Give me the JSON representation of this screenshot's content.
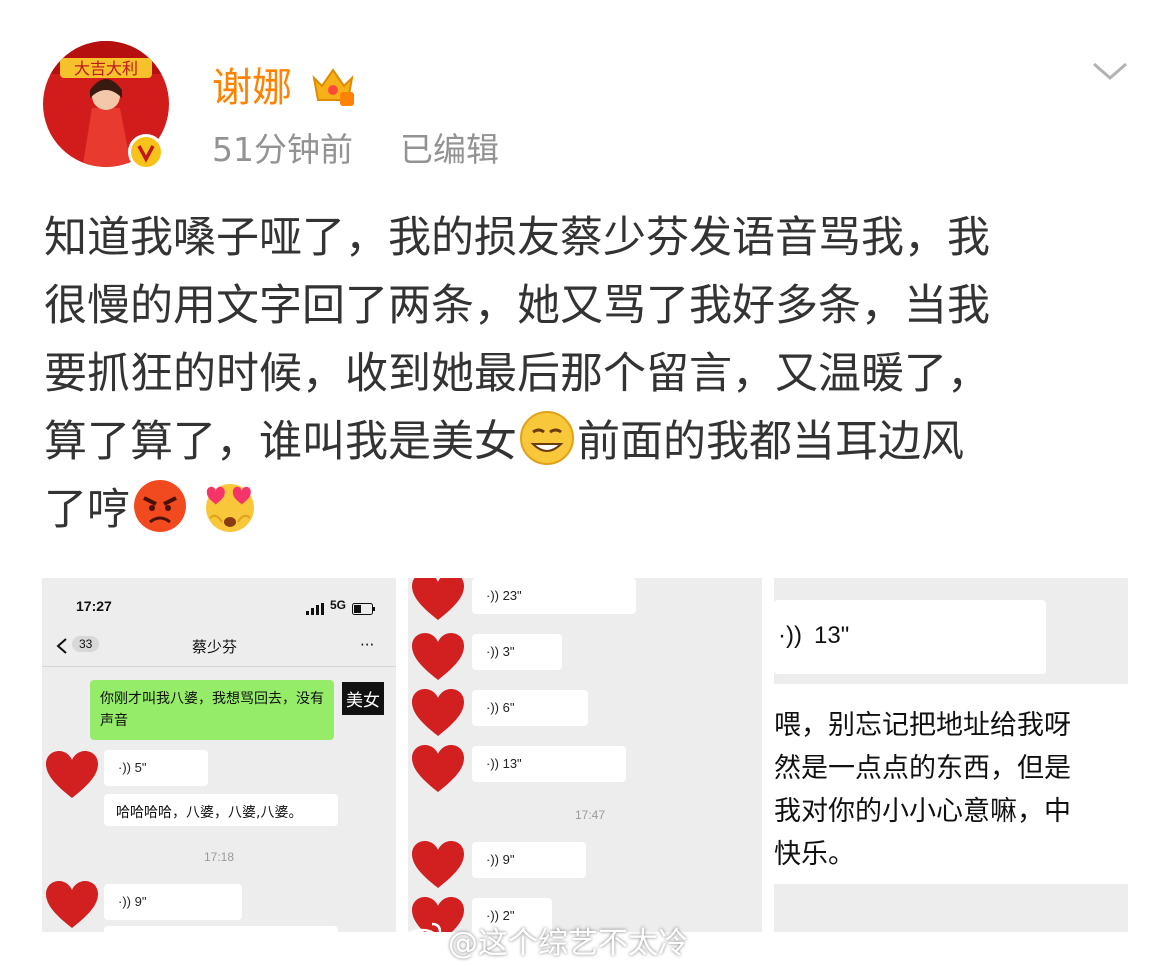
{
  "post": {
    "author": "谢娜",
    "time_ago": "51分钟前",
    "edited": "已编辑",
    "text_lines": [
      "知道我嗓子哑了，我的损友蔡少芬发语音骂我，我",
      "很慢的用文字回了两条，她又骂了我好多条，当我",
      "要抓狂的时候，收到她最后那个留言，又温暖了，",
      "算了算了，谁叫我是美女",
      "前面的我都当耳边风",
      "了哼"
    ]
  },
  "shot1": {
    "time": "17:27",
    "network": "5G",
    "back_count": "33",
    "contact": "蔡少芬",
    "more": "···",
    "sent_text": "你刚才叫我八婆，我想骂回去，没有声音",
    "sticker_text": "美女",
    "voice1": "5\"",
    "recv_text": "哈哈哈哈，八婆，八婆,八婆。",
    "timestamp": "17:18",
    "voice2": "9\""
  },
  "shot2": {
    "voices": [
      "23\"",
      "3\"",
      "6\"",
      "13\""
    ],
    "timestamp": "17:47",
    "voices2": [
      "9\"",
      "2\""
    ]
  },
  "shot3": {
    "voice": "13\"",
    "message_lines": [
      "喂，别忘记把地址给我呀",
      "然是一点点的东西，但是",
      "我对你的小小心意嘛，中",
      "快乐。"
    ]
  },
  "watermark": "@这个综艺不太冷"
}
